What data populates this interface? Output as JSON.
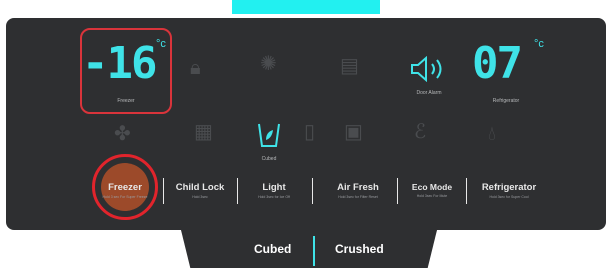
{
  "colors": {
    "accent": "#3fe3e8",
    "highlight": "#e1242c",
    "panel": "#2e2f31"
  },
  "freezer_display": {
    "value": "-16",
    "unit": "°c",
    "label": "Freezer"
  },
  "fridge_display": {
    "value": "07",
    "unit": "°c",
    "label": "Refrigerator"
  },
  "door_alarm": {
    "icon": "speaker-icon",
    "label": "Door Alarm"
  },
  "dispenser_icon": {
    "icon": "cup-icon",
    "label": "Cubed"
  },
  "buttons": [
    {
      "label": "Freezer",
      "sub": "Hold 3 sec For Super Freeze"
    },
    {
      "label": "Child Lock",
      "sub": "Hold 3sec"
    },
    {
      "label": "Light",
      "sub": "Hold 3sec for Ice Off"
    },
    {
      "label": "Air Fresh",
      "sub": "Hold 3sec for Filter Reset"
    },
    {
      "label": "Eco Mode",
      "sub": "Hold 3sec For Mute"
    },
    {
      "label": "Refrigerator",
      "sub": "Hold 3sec for Super Cool"
    }
  ],
  "dispense": {
    "cubed": "Cubed",
    "crushed": "Crushed"
  }
}
